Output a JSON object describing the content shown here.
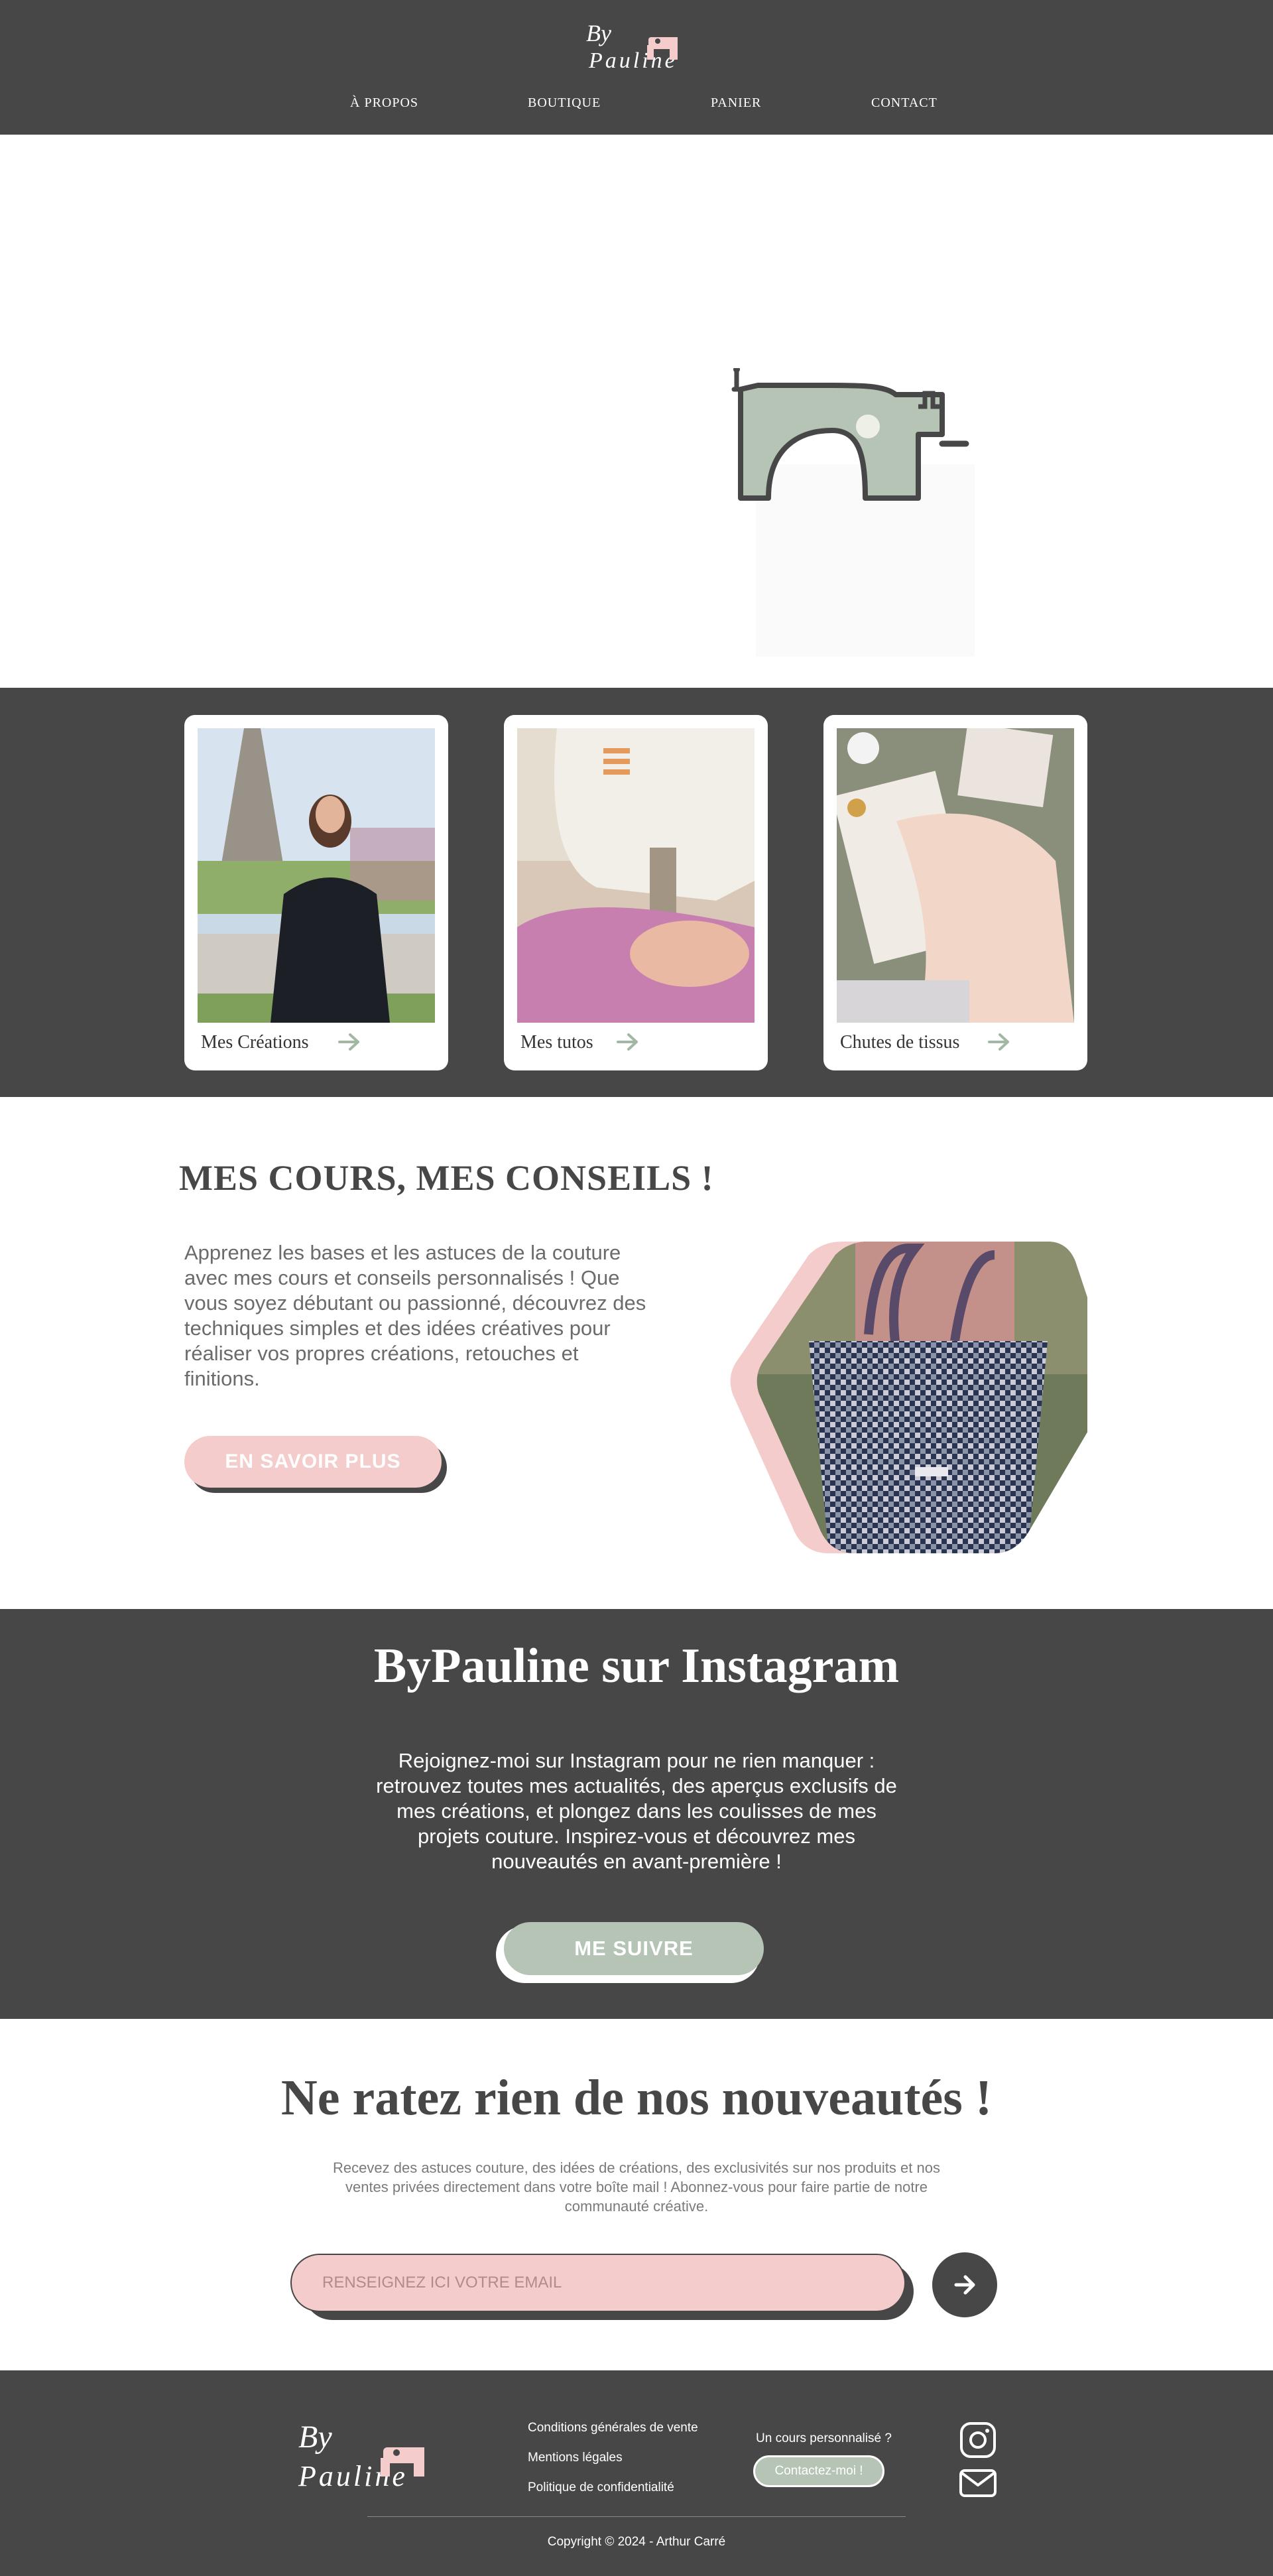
{
  "brand": {
    "logo_text_top": "By",
    "logo_text_bottom": "Pauline"
  },
  "nav": {
    "items": [
      {
        "label": "À PROPOS"
      },
      {
        "label": "BOUTIQUE"
      },
      {
        "label": "PANIER"
      },
      {
        "label": "CONTACT"
      }
    ]
  },
  "hero": {
    "illustration": "sewing-machine-icon"
  },
  "cards": [
    {
      "caption": "Mes Créations",
      "image": "woman-eiffel-tower-photo"
    },
    {
      "caption": "Mes tutos",
      "image": "sewing-machine-photo"
    },
    {
      "caption": "Chutes de tissus",
      "image": "fabric-scraps-photo"
    }
  ],
  "courses": {
    "title": "MES COURS, MES CONSEILS !",
    "text": "Apprenez les bases et les astuces de la couture avec mes cours et conseils personnalisés ! Que vous soyez débutant ou passionné, découvrez des techniques simples et des idées créatives pour réaliser vos propres créations, retouches et finitions.",
    "button": "EN SAVOIR PLUS",
    "image": "houndstooth-tote-bag-photo"
  },
  "instagram": {
    "title": "ByPauline sur Instagram",
    "text": "Rejoignez-moi sur Instagram pour ne rien manquer : retrouvez toutes mes actualités, des aperçus exclusifs de mes créations, et plongez dans les coulisses de mes projets couture. Inspirez-vous et découvrez mes nouveautés en avant-première !",
    "button": "ME SUIVRE"
  },
  "newsletter": {
    "title": "Ne ratez rien de nos nouveautés !",
    "text": "Recevez des astuces couture, des idées de créations, des exclusivités sur nos produits et nos ventes privées directement dans votre boîte mail ! Abonnez-vous pour faire partie de notre communauté créative.",
    "placeholder": "RENSEIGNEZ ICI VOTRE EMAIL",
    "submit_icon": "arrow-right-icon"
  },
  "footer": {
    "links": [
      {
        "label": "Conditions générales de vente"
      },
      {
        "label": "Mentions légales"
      },
      {
        "label": "Politique de confidentialité"
      }
    ],
    "question": "Un cours personnalisé ?",
    "button": "Contactez-moi !",
    "copyright": "Copyright © 2024 - Arthur Carré"
  },
  "colors": {
    "dark": "#474747",
    "pink": "#f3cccb",
    "sage": "#b5c4b5",
    "white": "#ffffff"
  }
}
